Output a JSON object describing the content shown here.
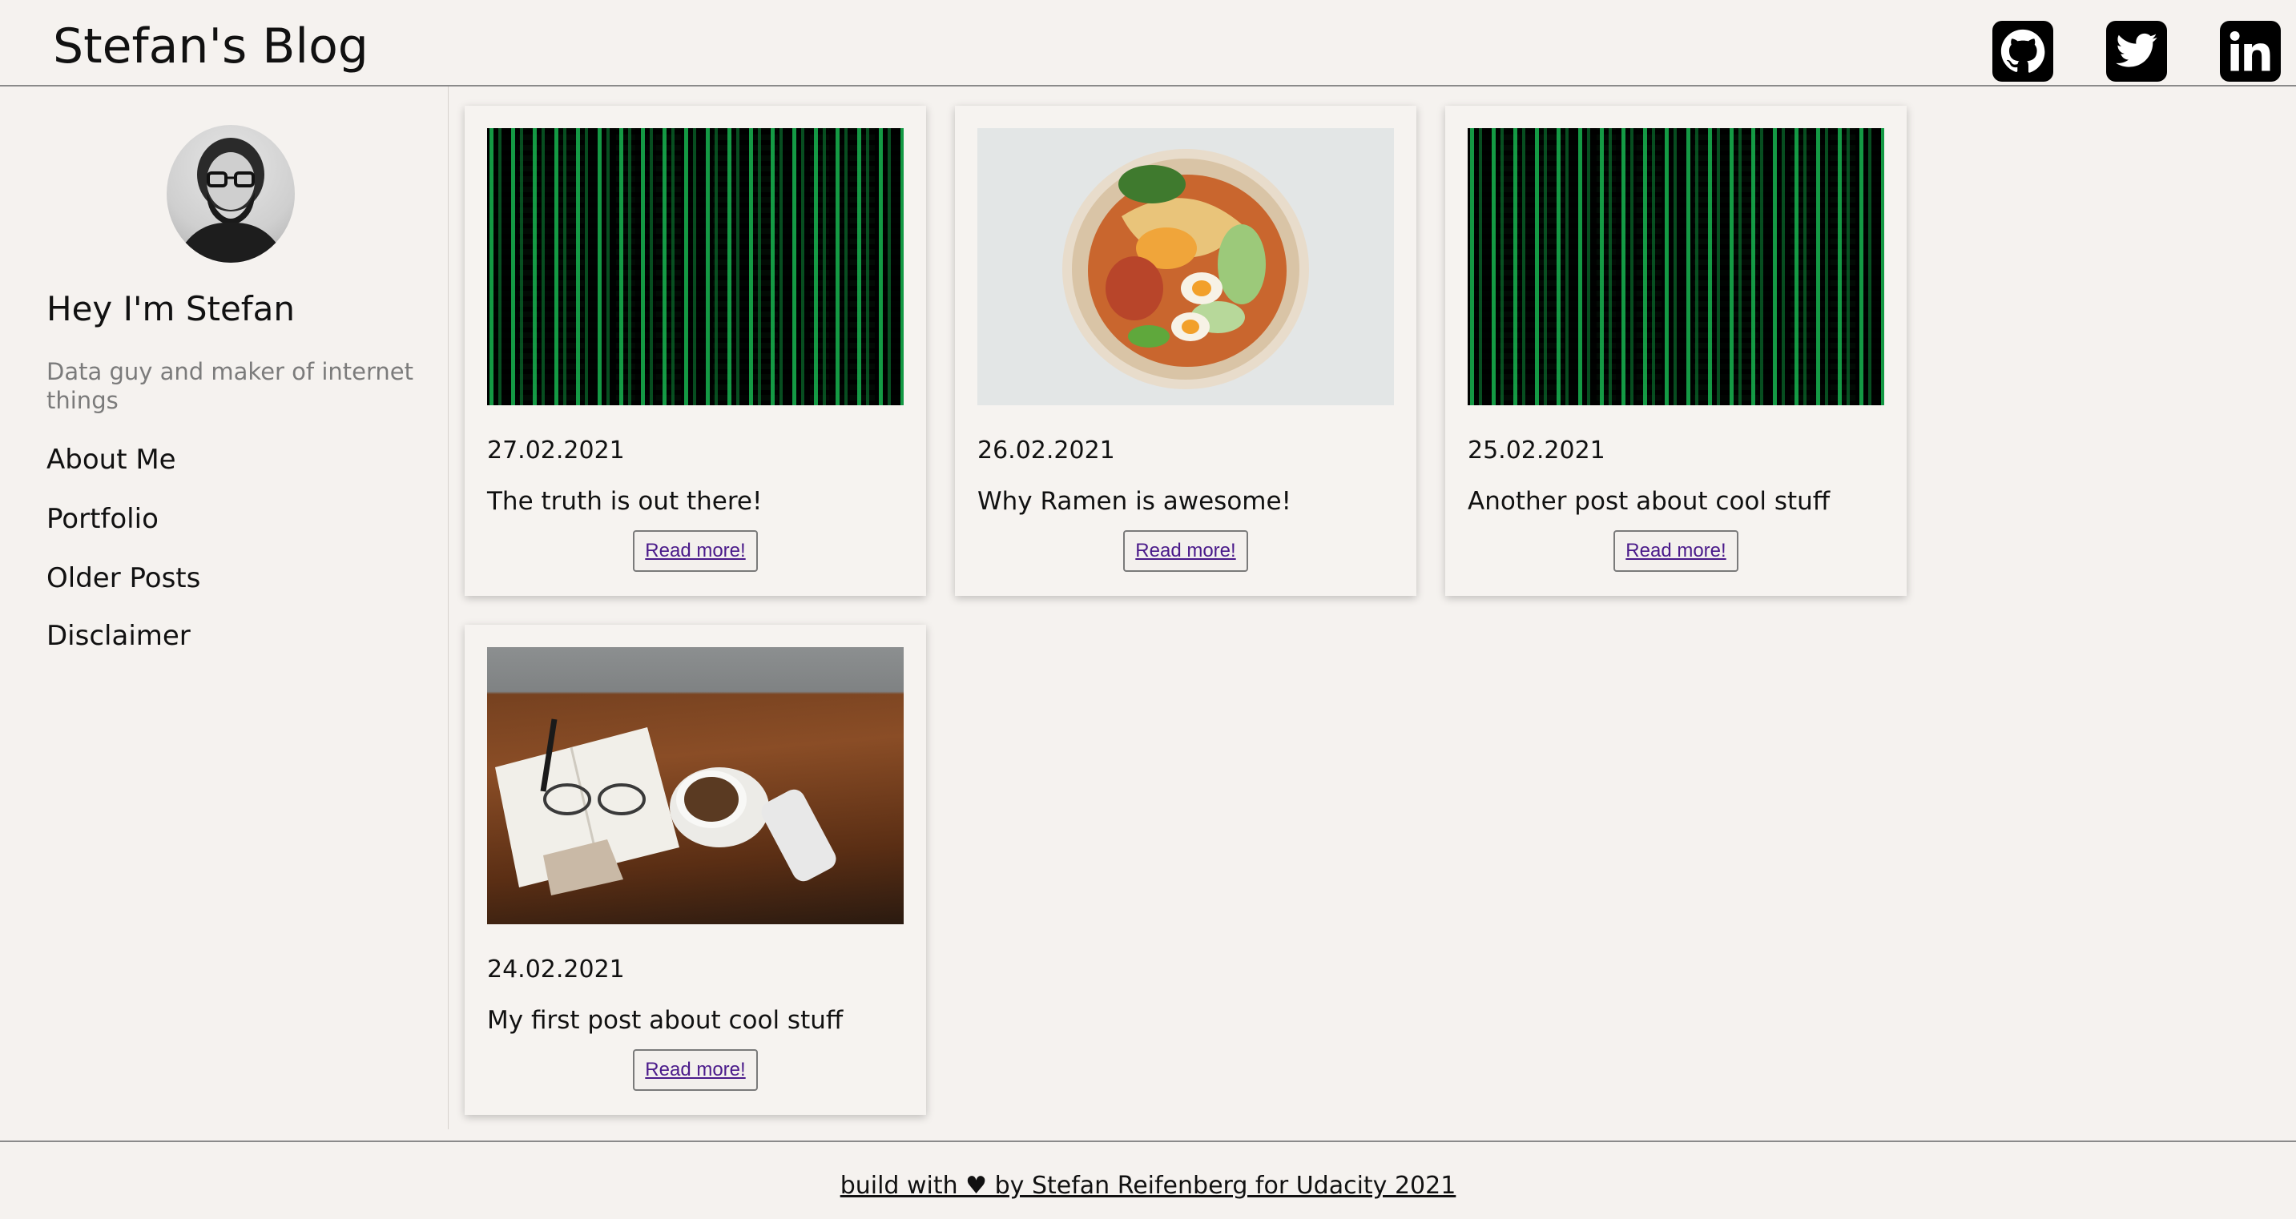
{
  "header": {
    "title": "Stefan's Blog",
    "social": [
      {
        "name": "github-icon"
      },
      {
        "name": "twitter-icon"
      },
      {
        "name": "linkedin-icon"
      }
    ]
  },
  "sidebar": {
    "greeting": "Hey I'm Stefan",
    "tagline": "Data guy and maker of internet things",
    "nav": [
      {
        "label": "About Me"
      },
      {
        "label": "Portfolio"
      },
      {
        "label": "Older Posts"
      },
      {
        "label": "Disclaimer"
      }
    ]
  },
  "posts": [
    {
      "date": "27.02.2021",
      "title": "The truth is out there!",
      "image": "matrix-code",
      "button": "Read more!"
    },
    {
      "date": "26.02.2021",
      "title": "Why Ramen is awesome!",
      "image": "ramen-bowl",
      "button": "Read more!"
    },
    {
      "date": "25.02.2021",
      "title": "Another post about cool stuff",
      "image": "matrix-code",
      "button": "Read more!"
    },
    {
      "date": "24.02.2021",
      "title": "My first post about cool stuff",
      "image": "desk-coffee-notebook",
      "button": "Read more!"
    }
  ],
  "footer": {
    "text": "build with ♥ by Stefan Reifenberg for Udacity 2021"
  },
  "colors": {
    "background": "#f5f2ef",
    "link": "#4a1a8a",
    "tagline": "#7b7b7b"
  }
}
